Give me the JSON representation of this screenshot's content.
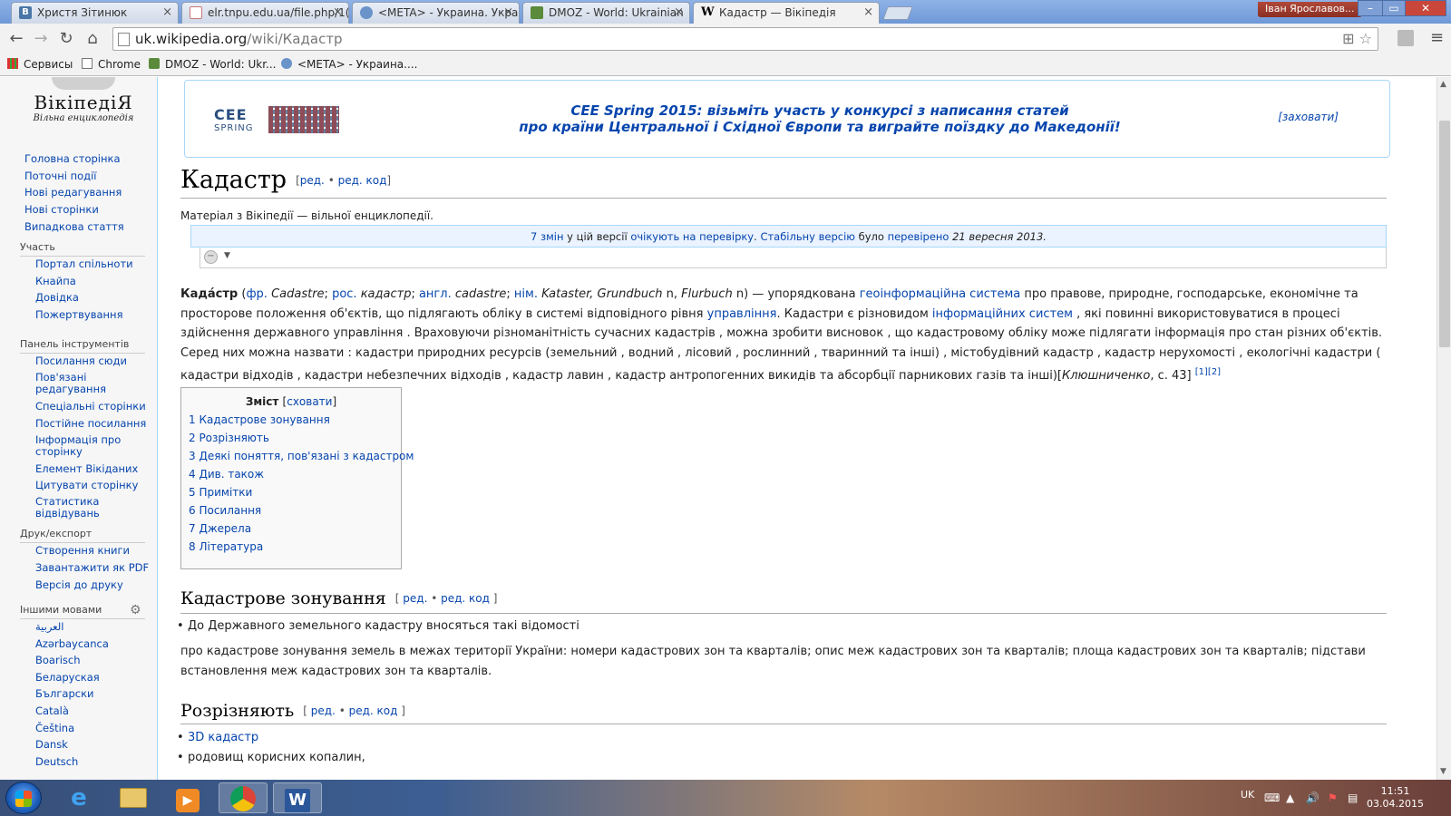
{
  "browser": {
    "tabs": [
      {
        "title": "Христя Зітинюк",
        "icon": "vk-icon",
        "active": false
      },
      {
        "title": "elr.tnpu.edu.ua/file.php/1(",
        "icon": "page-icon",
        "active": false
      },
      {
        "title": "<META> - Украина. Укра",
        "icon": "meta-icon",
        "active": false
      },
      {
        "title": "DMOZ - World: Ukrainian",
        "icon": "dmoz-icon",
        "active": false
      },
      {
        "title": "Кадастр — Вікіпедія",
        "icon": "wikipedia-icon",
        "active": true
      }
    ],
    "profile": "Іван Ярославов...",
    "url_domain": "uk.wikipedia.org",
    "url_path": "/wiki/Кадастр",
    "bookmarks": [
      {
        "label": "Сервисы",
        "icon": "apps-icon"
      },
      {
        "label": "Chrome",
        "icon": "folder-icon"
      },
      {
        "label": "DMOZ - World: Ukr...",
        "icon": "dmoz-icon"
      },
      {
        "label": "<META> - Украина....",
        "icon": "meta-icon"
      }
    ]
  },
  "sidebar": {
    "logo_name": "ВікіпедіЯ",
    "logo_tagline": "Вільна енциклопедія",
    "main_links": [
      "Головна сторінка",
      "Поточні події",
      "Нові редагування",
      "Нові сторінки",
      "Випадкова стаття"
    ],
    "participation_head": "Участь",
    "participation_links": [
      "Портал спільноти",
      "Кнайпа",
      "Довідка",
      "Пожертвування"
    ],
    "tools_head": "Панель інструментів",
    "tools_links": [
      "Посилання сюди",
      "Пов'язані редагування",
      "Спеціальні сторінки",
      "Постійне посилання",
      "Інформація про сторінку",
      "Елемент Вікіданих",
      "Цитувати сторінку",
      "Статистика відвідувань"
    ],
    "print_head": "Друк/експорт",
    "print_links": [
      "Створення книги",
      "Завантажити як PDF",
      "Версія до друку"
    ],
    "languages_head": "Іншими мовами",
    "language_links": [
      "العربية",
      "Azərbaycanca",
      "Boarisch",
      "Беларуская",
      "Български",
      "Català",
      "Čeština",
      "Dansk",
      "Deutsch"
    ]
  },
  "banner": {
    "logo_top": "CEE",
    "logo_bottom": "SPRING",
    "line1": "CEE Spring 2015: візьміть участь у конкурсі з написання статей",
    "line2": "про країни Центральної і Східної Європи та виграйте поїздку до Македонії!",
    "hide_label": "[заховати]"
  },
  "article": {
    "title": "Кадастр",
    "edit_links": {
      "open": "[",
      "edit": "ред.",
      "sep": "•",
      "edit_source": "ред. код",
      "close": "]"
    },
    "subtitle": "Матеріал з Вікіпедії — вільної енциклопедії.",
    "review": {
      "changes": "7 змін",
      "t1": " у цій версії ",
      "pending": "очікують на перевірку",
      "t2": ". ",
      "stable": "Стабільну версію",
      "t3": " було ",
      "checked": "перевірено",
      "date": " 21 вересня 2013."
    },
    "lead": {
      "term": "Када́стр",
      "p1": " (",
      "fr": "фр.",
      "fr_word": " Cadastre",
      "sc1": "; ",
      "ru": "рос.",
      "ru_word": " кадастр",
      "sc2": "; ",
      "en": "англ.",
      "en_word": " cadastre",
      "sc3": "; ",
      "de": "нім.",
      "de_word": " Kataster, Grundbuch",
      "n1": " n, ",
      "de_word2": "Flurbuch",
      "n2": " n) — упорядкована ",
      "gis": "геоінформаційна система",
      "t1": " про правове, природне, господарське, економічне та просторове положення об'єктів, що підлягають обліку в системі відповідного рівня ",
      "mgmt": "управління",
      "t2": ". Кадастри є різновидом ",
      "infosys": "інформаційних систем",
      "t3": " , які повинні використовуватися в процесі здійснення державного управління . Враховуючи різноманітність сучасних кадастрів , можна зробити висновок , що кадастровому обліку може підлягати інформація про стан різних об'єктів. Серед них можна назвати : кадастри природних ресурсів (земельний , водний , лісовий , рослинний , тваринний та інші) , містобудівний кадастр , кадастр нерухомості , екологічні кадастри ( кадастри відходів , кадастри небезпечних відходів , кадастр лавин , кадастр антропогенних викидів та абсорбції парникових газів та інші)[",
      "author": "Клюшниченко",
      "t4": ", с. 43] ",
      "ref1": "[1]",
      "ref2": "[2]"
    },
    "toc": {
      "title": "Зміст",
      "toggle_open": "[",
      "toggle": "сховати",
      "toggle_close": "]",
      "items": [
        "1 Кадастрове зонування",
        "2 Розрізняють",
        "3 Деякі поняття, пов'язані з кадастром",
        "4 Див. також",
        "5 Примітки",
        "6 Посилання",
        "7 Джерела",
        "8 Література"
      ]
    },
    "sections": [
      {
        "heading": "Кадастрове зонування",
        "edit_open": "[ ",
        "edit": "ред.",
        "sep": " • ",
        "edit_source": "ред. код",
        "edit_close": " ]",
        "bullet": "До Державного земельного кадастру вносяться такі відомості",
        "paragraph": "про кадастрове зонування земель в межах території України: номери кадастрових зон та кварталів; опис меж кадастрових зон та кварталів; площа кадастрових зон та кварталів; підстави встановлення меж кадастрових зон та кварталів."
      },
      {
        "heading": "Розрізняють",
        "edit_open": "[ ",
        "edit": "ред.",
        "sep": " • ",
        "edit_source": "ред. код",
        "edit_close": " ]",
        "bullets": [
          "3D кадастр",
          "родовищ корисних копалин,"
        ]
      }
    ]
  },
  "taskbar": {
    "apps": [
      {
        "name": "internet-explorer",
        "icon": "ie-icon"
      },
      {
        "name": "file-explorer",
        "icon": "folder-icon"
      },
      {
        "name": "media-player",
        "icon": "media-icon"
      },
      {
        "name": "chrome",
        "icon": "chrome-icon"
      },
      {
        "name": "word",
        "icon": "word-icon"
      }
    ],
    "language": "UK",
    "time": "11:51",
    "date": "03.04.2015"
  }
}
